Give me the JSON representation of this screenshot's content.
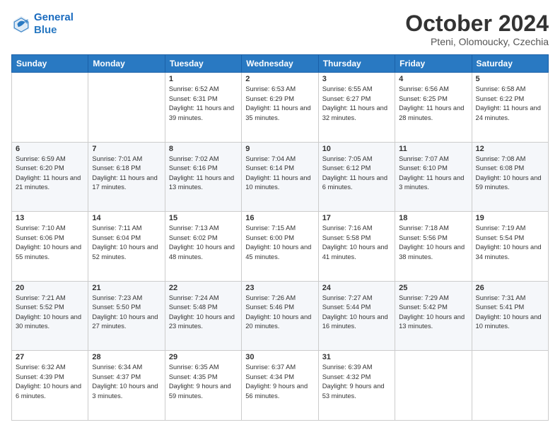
{
  "header": {
    "logo_line1": "General",
    "logo_line2": "Blue",
    "title": "October 2024",
    "subtitle": "Pteni, Olomoucky, Czechia"
  },
  "columns": [
    "Sunday",
    "Monday",
    "Tuesday",
    "Wednesday",
    "Thursday",
    "Friday",
    "Saturday"
  ],
  "weeks": [
    [
      {
        "day": "",
        "detail": ""
      },
      {
        "day": "",
        "detail": ""
      },
      {
        "day": "1",
        "detail": "Sunrise: 6:52 AM\nSunset: 6:31 PM\nDaylight: 11 hours and 39 minutes."
      },
      {
        "day": "2",
        "detail": "Sunrise: 6:53 AM\nSunset: 6:29 PM\nDaylight: 11 hours and 35 minutes."
      },
      {
        "day": "3",
        "detail": "Sunrise: 6:55 AM\nSunset: 6:27 PM\nDaylight: 11 hours and 32 minutes."
      },
      {
        "day": "4",
        "detail": "Sunrise: 6:56 AM\nSunset: 6:25 PM\nDaylight: 11 hours and 28 minutes."
      },
      {
        "day": "5",
        "detail": "Sunrise: 6:58 AM\nSunset: 6:22 PM\nDaylight: 11 hours and 24 minutes."
      }
    ],
    [
      {
        "day": "6",
        "detail": "Sunrise: 6:59 AM\nSunset: 6:20 PM\nDaylight: 11 hours and 21 minutes."
      },
      {
        "day": "7",
        "detail": "Sunrise: 7:01 AM\nSunset: 6:18 PM\nDaylight: 11 hours and 17 minutes."
      },
      {
        "day": "8",
        "detail": "Sunrise: 7:02 AM\nSunset: 6:16 PM\nDaylight: 11 hours and 13 minutes."
      },
      {
        "day": "9",
        "detail": "Sunrise: 7:04 AM\nSunset: 6:14 PM\nDaylight: 11 hours and 10 minutes."
      },
      {
        "day": "10",
        "detail": "Sunrise: 7:05 AM\nSunset: 6:12 PM\nDaylight: 11 hours and 6 minutes."
      },
      {
        "day": "11",
        "detail": "Sunrise: 7:07 AM\nSunset: 6:10 PM\nDaylight: 11 hours and 3 minutes."
      },
      {
        "day": "12",
        "detail": "Sunrise: 7:08 AM\nSunset: 6:08 PM\nDaylight: 10 hours and 59 minutes."
      }
    ],
    [
      {
        "day": "13",
        "detail": "Sunrise: 7:10 AM\nSunset: 6:06 PM\nDaylight: 10 hours and 55 minutes."
      },
      {
        "day": "14",
        "detail": "Sunrise: 7:11 AM\nSunset: 6:04 PM\nDaylight: 10 hours and 52 minutes."
      },
      {
        "day": "15",
        "detail": "Sunrise: 7:13 AM\nSunset: 6:02 PM\nDaylight: 10 hours and 48 minutes."
      },
      {
        "day": "16",
        "detail": "Sunrise: 7:15 AM\nSunset: 6:00 PM\nDaylight: 10 hours and 45 minutes."
      },
      {
        "day": "17",
        "detail": "Sunrise: 7:16 AM\nSunset: 5:58 PM\nDaylight: 10 hours and 41 minutes."
      },
      {
        "day": "18",
        "detail": "Sunrise: 7:18 AM\nSunset: 5:56 PM\nDaylight: 10 hours and 38 minutes."
      },
      {
        "day": "19",
        "detail": "Sunrise: 7:19 AM\nSunset: 5:54 PM\nDaylight: 10 hours and 34 minutes."
      }
    ],
    [
      {
        "day": "20",
        "detail": "Sunrise: 7:21 AM\nSunset: 5:52 PM\nDaylight: 10 hours and 30 minutes."
      },
      {
        "day": "21",
        "detail": "Sunrise: 7:23 AM\nSunset: 5:50 PM\nDaylight: 10 hours and 27 minutes."
      },
      {
        "day": "22",
        "detail": "Sunrise: 7:24 AM\nSunset: 5:48 PM\nDaylight: 10 hours and 23 minutes."
      },
      {
        "day": "23",
        "detail": "Sunrise: 7:26 AM\nSunset: 5:46 PM\nDaylight: 10 hours and 20 minutes."
      },
      {
        "day": "24",
        "detail": "Sunrise: 7:27 AM\nSunset: 5:44 PM\nDaylight: 10 hours and 16 minutes."
      },
      {
        "day": "25",
        "detail": "Sunrise: 7:29 AM\nSunset: 5:42 PM\nDaylight: 10 hours and 13 minutes."
      },
      {
        "day": "26",
        "detail": "Sunrise: 7:31 AM\nSunset: 5:41 PM\nDaylight: 10 hours and 10 minutes."
      }
    ],
    [
      {
        "day": "27",
        "detail": "Sunrise: 6:32 AM\nSunset: 4:39 PM\nDaylight: 10 hours and 6 minutes."
      },
      {
        "day": "28",
        "detail": "Sunrise: 6:34 AM\nSunset: 4:37 PM\nDaylight: 10 hours and 3 minutes."
      },
      {
        "day": "29",
        "detail": "Sunrise: 6:35 AM\nSunset: 4:35 PM\nDaylight: 9 hours and 59 minutes."
      },
      {
        "day": "30",
        "detail": "Sunrise: 6:37 AM\nSunset: 4:34 PM\nDaylight: 9 hours and 56 minutes."
      },
      {
        "day": "31",
        "detail": "Sunrise: 6:39 AM\nSunset: 4:32 PM\nDaylight: 9 hours and 53 minutes."
      },
      {
        "day": "",
        "detail": ""
      },
      {
        "day": "",
        "detail": ""
      }
    ]
  ]
}
